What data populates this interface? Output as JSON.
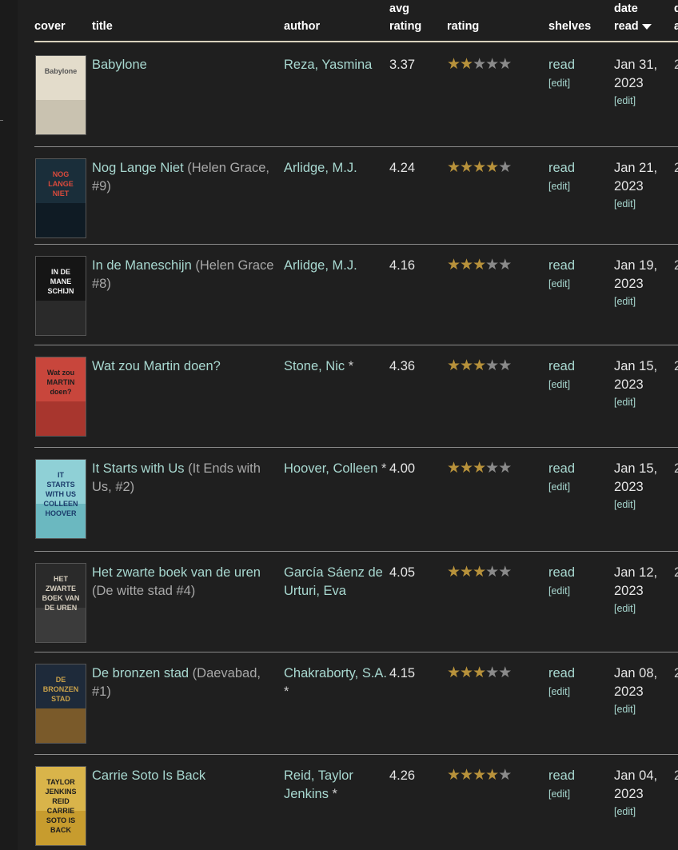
{
  "header": {
    "cover": "cover",
    "title": "title",
    "author": "author",
    "avg_line1": "avg",
    "avg_line2": "rating",
    "rating": "rating",
    "shelves": "shelves",
    "date_line1": "date",
    "date_line2": "read"
  },
  "edit_label": "[edit]",
  "colors": {
    "background": "#1f1f1f",
    "link": "#a8d8d0",
    "star_on": "#b8923b",
    "star_off": "#8a8a8a"
  },
  "books": [
    {
      "title": "Babylone",
      "series": "",
      "author": "Reza, Yasmina",
      "author_star": "",
      "avg_rating": "3.37",
      "rating": 2,
      "shelf": "read",
      "date_line1": "Jan 31,",
      "date_line2": "2023",
      "cover_text": "Babylone",
      "cover_colors": [
        "#e3dccb",
        "#c9c2b0",
        "#555555"
      ]
    },
    {
      "title": "Nog Lange Niet",
      "series": "(Helen Grace, #9)",
      "author": "Arlidge, M.J.",
      "author_star": "",
      "avg_rating": "4.24",
      "rating": 4,
      "shelf": "read",
      "date_line1": "Jan 21,",
      "date_line2": "2023",
      "cover_text": "NOG LANGE NIET",
      "cover_colors": [
        "#1a2e3a",
        "#0f1b24",
        "#d94a3c"
      ]
    },
    {
      "title": "In de Maneschijn",
      "series": "(Helen Grace #8)",
      "author": "Arlidge, M.J.",
      "author_star": "",
      "avg_rating": "4.16",
      "rating": 3,
      "shelf": "read",
      "date_line1": "Jan 19,",
      "date_line2": "2023",
      "cover_text": "IN DE MANE SCHIJN",
      "cover_colors": [
        "#151515",
        "#2a2a2a",
        "#f0f0f0"
      ]
    },
    {
      "title": "Wat zou Martin doen?",
      "series": "",
      "author": "Stone, Nic",
      "author_star": "*",
      "avg_rating": "4.36",
      "rating": 3,
      "shelf": "read",
      "date_line1": "Jan 15,",
      "date_line2": "2023",
      "cover_text": "Wat zou MARTIN doen?",
      "cover_colors": [
        "#c8463c",
        "#a8362e",
        "#1d1d1d"
      ]
    },
    {
      "title": "It Starts with Us",
      "series": "(It Ends with Us, #2)",
      "author": "Hoover, Colleen",
      "author_star": "*",
      "avg_rating": "4.00",
      "rating": 3,
      "shelf": "read",
      "date_line1": "Jan 15,",
      "date_line2": "2023",
      "cover_text": "IT STARTS WITH US COLLEEN HOOVER",
      "cover_colors": [
        "#8fd0d6",
        "#6bb8c0",
        "#1b3c6b"
      ]
    },
    {
      "title": "Het zwarte boek van de uren",
      "series": "(De witte stad #4)",
      "author": "García Sáenz de Urturi, Eva",
      "author_star": "",
      "avg_rating": "4.05",
      "rating": 3,
      "shelf": "read",
      "date_line1": "Jan 12,",
      "date_line2": "2023",
      "cover_text": "HET ZWARTE BOEK VAN DE UREN",
      "cover_colors": [
        "#2a2a2a",
        "#3b3b3b",
        "#d8d0c0"
      ]
    },
    {
      "title": "De bronzen stad",
      "series": "(Daevabad, #1)",
      "author": "Chakraborty, S.A.",
      "author_star": "*",
      "avg_rating": "4.15",
      "rating": 3,
      "shelf": "read",
      "date_line1": "Jan 08,",
      "date_line2": "2023",
      "cover_text": "DE BRONZEN STAD",
      "cover_colors": [
        "#1e2a3a",
        "#7a5a2a",
        "#c9a14a"
      ]
    },
    {
      "title": "Carrie Soto Is Back",
      "series": "",
      "author": "Reid, Taylor Jenkins",
      "author_star": "*",
      "avg_rating": "4.26",
      "rating": 4,
      "shelf": "read",
      "date_line1": "Jan 04,",
      "date_line2": "2023",
      "cover_text": "TAYLOR JENKINS REID CARRIE SOTO IS BACK",
      "cover_colors": [
        "#d9b44a",
        "#c79c2e",
        "#1d1d1d"
      ]
    }
  ]
}
